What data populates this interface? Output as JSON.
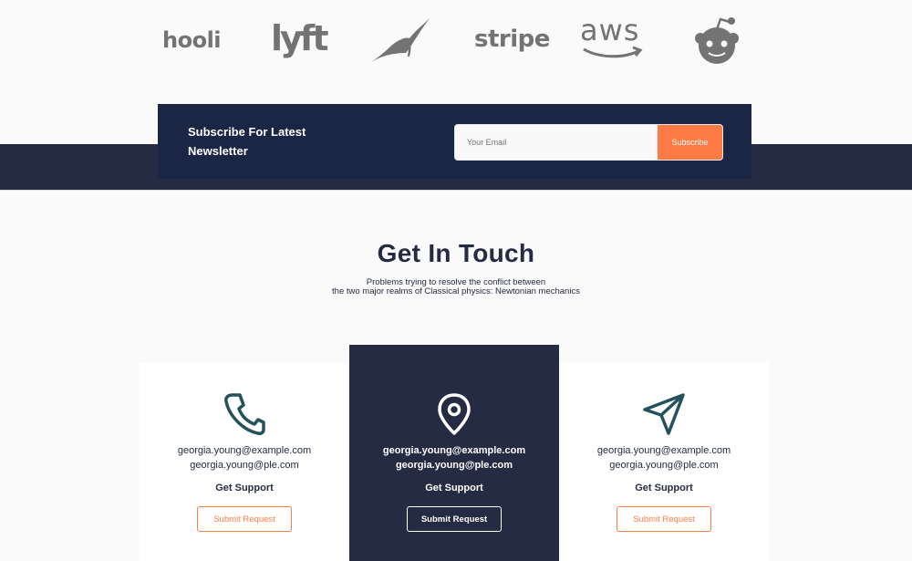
{
  "logos": {
    "hooli": "hooli",
    "lyft": "lyft",
    "stripe": "stripe",
    "aws": "aws",
    "icons": [
      "hooli-logo",
      "lyft-logo",
      "leaf-logo",
      "stripe-logo",
      "aws-logo",
      "reddit-logo"
    ]
  },
  "newsletter": {
    "title_line1": "Subscribe For Latest",
    "title_line2": "Newsletter",
    "email_placeholder": "Your Email",
    "subscribe_label": "Subscribe"
  },
  "touch": {
    "title": "Get In Touch",
    "subtitle_line1": "Problems trying to resolve the conflict between",
    "subtitle_line2": "the two major realms of Classical physics: Newtonian mechanics"
  },
  "cards": [
    {
      "icon": "phone-icon",
      "email1": "georgia.young@example.com",
      "email2": "georgia.young@ple.com",
      "heading": "Get Support",
      "button": "Submit Request"
    },
    {
      "icon": "location-pin-icon",
      "email1": "georgia.young@example.com",
      "email2": "georgia.young@ple.com",
      "heading": "Get Support",
      "button": "Submit Request"
    },
    {
      "icon": "send-icon",
      "email1": "georgia.young@example.com",
      "email2": "georgia.young@ple.com",
      "heading": "Get Support",
      "button": "Submit Request"
    }
  ],
  "colors": {
    "navy": "#252b42",
    "newsletter_bg": "#1b2544",
    "accent": "#ff7b45",
    "icon_teal": "#23525d",
    "logo_gray": "#737373"
  }
}
